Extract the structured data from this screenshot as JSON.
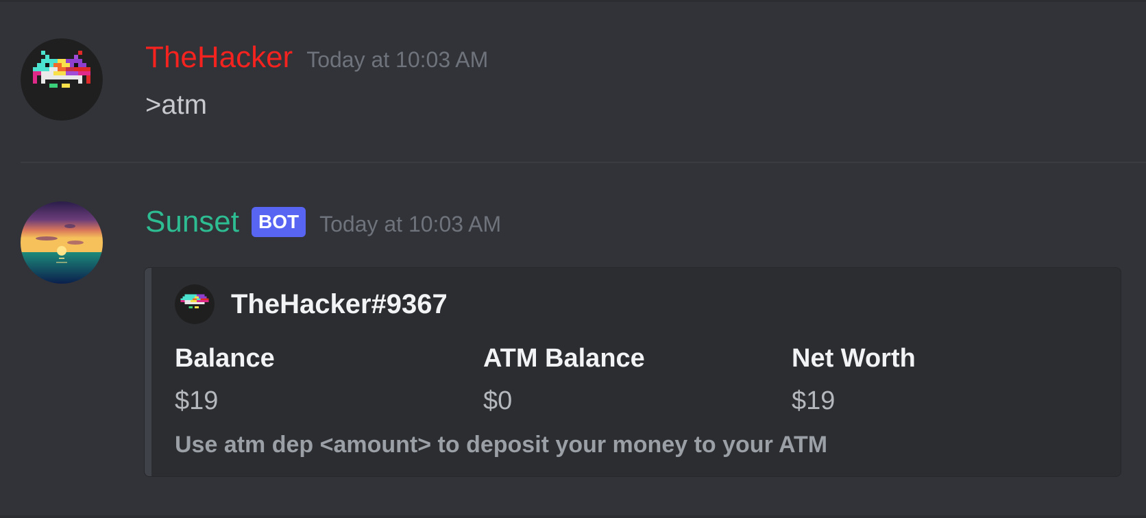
{
  "messages": [
    {
      "author": "TheHacker",
      "author_color": "#f4231f",
      "avatar_icon": "space-invader-icon",
      "timestamp": "Today at 10:03 AM",
      "content": ">atm"
    },
    {
      "author": "Sunset",
      "author_color": "#2ebd93",
      "avatar_icon": "sunset-icon",
      "bot_tag": "BOT",
      "timestamp": "Today at 10:03 AM",
      "embed": {
        "author_icon": "space-invader-icon",
        "author_name": "TheHacker#9367",
        "fields": [
          {
            "name": "Balance",
            "value": "$19"
          },
          {
            "name": "ATM Balance",
            "value": "$0"
          },
          {
            "name": "Net Worth",
            "value": "$19"
          }
        ],
        "description": "Use atm dep <amount> to deposit your money to your ATM"
      }
    }
  ],
  "colors": {
    "background": "#313338",
    "embed_background": "#2b2d31",
    "bot_tag": "#5865f2"
  }
}
